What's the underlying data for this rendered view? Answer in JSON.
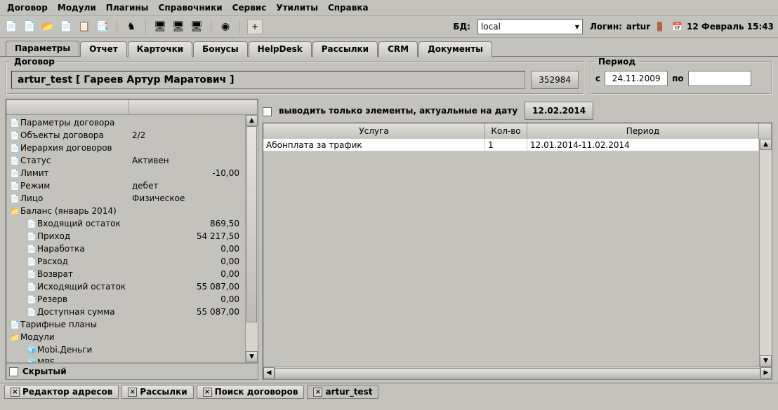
{
  "menu": [
    "Договор",
    "Модули",
    "Плагины",
    "Справочники",
    "Сервис",
    "Утилиты",
    "Справка"
  ],
  "toolbar": {
    "icons": [
      {
        "name": "file-yellow-icon",
        "glyph": "📄"
      },
      {
        "name": "file-new-icon",
        "glyph": "📄"
      },
      {
        "name": "folder-icon",
        "glyph": "📂"
      },
      {
        "name": "file-icon",
        "glyph": "📄"
      },
      {
        "name": "copy-icon",
        "glyph": "📋"
      },
      {
        "name": "files-icon",
        "glyph": "📑"
      }
    ],
    "icons2": [
      {
        "name": "stack-icon",
        "glyph": "♞"
      }
    ],
    "icons3": [
      {
        "name": "monitor-blue-icon",
        "glyph": "🖥"
      },
      {
        "name": "monitor-green-icon",
        "glyph": "🖥"
      },
      {
        "name": "monitor-red-icon",
        "glyph": "🖥"
      }
    ],
    "icons4": [
      {
        "name": "refresh-icon",
        "glyph": "◉"
      }
    ],
    "plus": "+",
    "db_label": "БД:",
    "db_value": "local",
    "login_label": "Логин:",
    "login_value": "artur",
    "datetime": "12 Февраль 15:43"
  },
  "tabs": [
    "Параметры",
    "Отчет",
    "Карточки",
    "Бонусы",
    "HelpDesk",
    "Рассылки",
    "CRM",
    "Документы"
  ],
  "contract": {
    "legend": "Договор",
    "title": "artur_test [ Гареев Артур Маратович ]",
    "id": "352984"
  },
  "period": {
    "legend": "Период",
    "from_label": "с",
    "from": "24.11.2009",
    "to_label": "по",
    "to": ""
  },
  "tree": [
    {
      "i": 0,
      "icon": "📄",
      "label": "Параметры договора",
      "val": ""
    },
    {
      "i": 0,
      "icon": "📄",
      "label": "Объекты договора",
      "val": "2/2",
      "valLeft": true
    },
    {
      "i": 0,
      "icon": "📄",
      "label": "Иерархия договоров",
      "val": ""
    },
    {
      "i": 0,
      "icon": "📄",
      "label": "Статус",
      "val": "Активен",
      "valLeft": true
    },
    {
      "i": 0,
      "icon": "📄",
      "label": "Лимит",
      "val": "-10,00"
    },
    {
      "i": 0,
      "icon": "📄",
      "label": "Режим",
      "val": "дебет",
      "valLeft": true
    },
    {
      "i": 0,
      "icon": "📄",
      "label": "Лицо",
      "val": "Физическое",
      "valLeft": true
    },
    {
      "i": 0,
      "icon": "📁",
      "label": "Баланс (январь 2014)",
      "val": ""
    },
    {
      "i": 1,
      "icon": "📄",
      "label": "Входящий остаток",
      "val": "869,50"
    },
    {
      "i": 1,
      "icon": "📄",
      "label": "Приход",
      "val": "54 217,50"
    },
    {
      "i": 1,
      "icon": "📄",
      "label": "Наработка",
      "val": "0,00"
    },
    {
      "i": 1,
      "icon": "📄",
      "label": "Расход",
      "val": "0,00"
    },
    {
      "i": 1,
      "icon": "📄",
      "label": "Возврат",
      "val": "0,00"
    },
    {
      "i": 1,
      "icon": "📄",
      "label": "Исходящий остаток",
      "val": "55 087,00"
    },
    {
      "i": 1,
      "icon": "📄",
      "label": "Резерв",
      "val": "0,00"
    },
    {
      "i": 1,
      "icon": "📄",
      "label": "Доступная сумма",
      "val": "55 087,00"
    },
    {
      "i": 0,
      "icon": "📄",
      "label": "Тарифные планы",
      "val": ""
    },
    {
      "i": 0,
      "icon": "📁",
      "label": "Модули",
      "val": ""
    },
    {
      "i": 1,
      "icon": "🧊",
      "label": "Mobi.Деньги",
      "val": ""
    },
    {
      "i": 1,
      "icon": "🧊",
      "label": "MPS",
      "val": ""
    }
  ],
  "hidden_label": "Скрытый",
  "filter": {
    "check_label": "выводить только элементы, актуальные на дату",
    "date": "12.02.2014"
  },
  "grid": {
    "headers": [
      "Услуга",
      "Кол-во",
      "Период"
    ],
    "rows": [
      {
        "service": "Абонплата за трафик",
        "qty": "1",
        "period": "12.01.2014-11.02.2014"
      }
    ]
  },
  "bottom_tabs": [
    {
      "label": "Редактор адресов",
      "closable": true,
      "active": false
    },
    {
      "label": "Рассылки",
      "closable": true,
      "active": false
    },
    {
      "label": "Поиск договоров",
      "closable": true,
      "active": false
    },
    {
      "label": "artur_test",
      "closable": true,
      "active": true
    }
  ]
}
